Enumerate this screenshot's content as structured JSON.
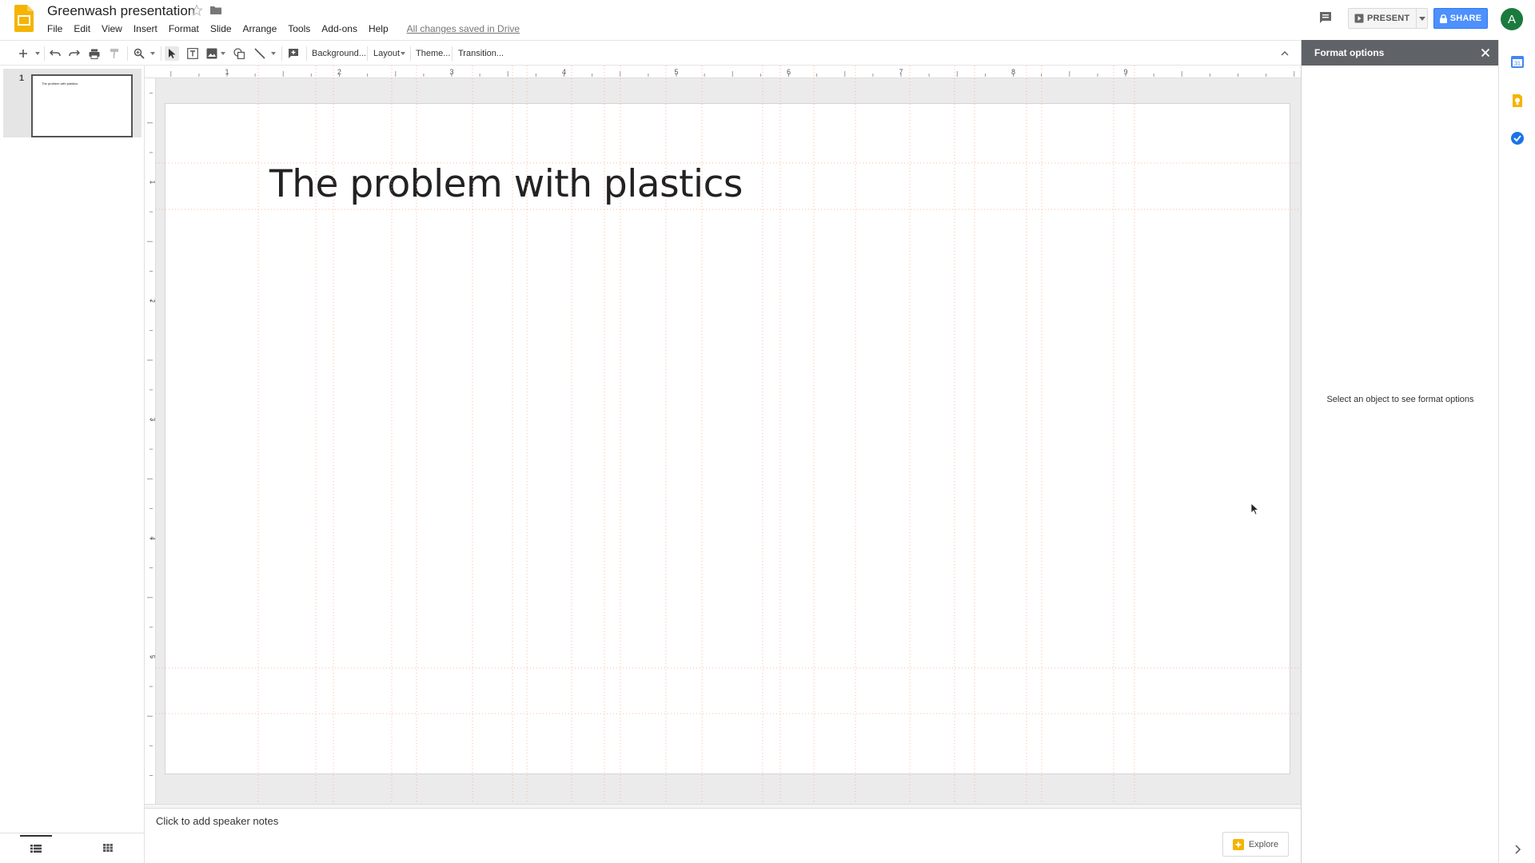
{
  "header": {
    "doc_title": "Greenwash presentation",
    "save_status": "All changes saved in Drive",
    "menu": [
      "File",
      "Edit",
      "View",
      "Insert",
      "Format",
      "Slide",
      "Arrange",
      "Tools",
      "Add-ons",
      "Help"
    ],
    "present_label": "PRESENT",
    "share_label": "SHARE",
    "avatar_initial": "A"
  },
  "toolbar": {
    "background_label": "Background...",
    "layout_label": "Layout",
    "theme_label": "Theme...",
    "transition_label": "Transition..."
  },
  "filmstrip": {
    "slides": [
      {
        "number": "1",
        "title": "The problem with plastics"
      }
    ]
  },
  "slide": {
    "title": "The problem with plastics"
  },
  "rulers": {
    "horizontal_numbers": [
      "1",
      "2",
      "3",
      "4",
      "5",
      "6",
      "7",
      "8",
      "9"
    ],
    "vertical_numbers": [
      "1",
      "2",
      "3",
      "4",
      "5"
    ]
  },
  "notes": {
    "placeholder": "Click to add speaker notes",
    "explore_label": "Explore"
  },
  "format_panel": {
    "title": "Format options",
    "hint": "Select an object to see format options"
  },
  "colors": {
    "accent_blue": "#4d90fe",
    "slides_yellow": "#f4b400",
    "avatar_green": "#1b7a3e",
    "panel_header": "#5f6368",
    "guide_orange": "#f4a582"
  },
  "icons": {
    "logo": "google-slides-logo",
    "star": "star-icon",
    "folder": "folder-icon",
    "comments": "comments-icon",
    "present": "present-icon",
    "lock": "lock-icon",
    "explore": "explore-icon",
    "calendar": "calendar-icon",
    "keep": "keep-icon",
    "tasks": "tasks-icon"
  }
}
